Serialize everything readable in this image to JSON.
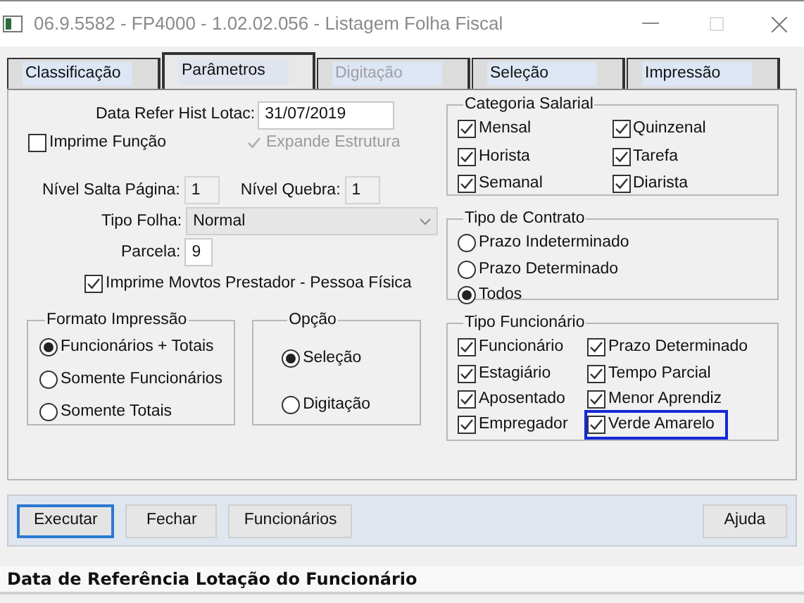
{
  "window": {
    "title": "06.9.5582 - FP4000 - 1.02.02.056 - Listagem Folha Fiscal"
  },
  "tabs": [
    {
      "label": "Classificação",
      "selected": false,
      "disabled": false
    },
    {
      "label": "Parâmetros",
      "selected": true,
      "disabled": false
    },
    {
      "label": "Digitação",
      "selected": false,
      "disabled": true
    },
    {
      "label": "Seleção",
      "selected": false,
      "disabled": false
    },
    {
      "label": "Impressão",
      "selected": false,
      "disabled": false
    }
  ],
  "date_field": {
    "label": "Data Refer Hist Lotac:",
    "value": "31/07/2019"
  },
  "imprime_funcao": {
    "label": "Imprime Função",
    "checked": false,
    "disabled": false
  },
  "expande_estrutura": {
    "label": "Expande Estrutura",
    "checked": true,
    "disabled": true
  },
  "nivel_salta_pagina": {
    "label": "Nível Salta Página:",
    "value": "1"
  },
  "nivel_quebra": {
    "label": "Nível Quebra:",
    "value": "1"
  },
  "tipo_folha": {
    "label": "Tipo Folha:",
    "value": "Normal"
  },
  "parcela": {
    "label": "Parcela:",
    "value": "9"
  },
  "imprime_movtos": {
    "label": "Imprime Movtos Prestador - Pessoa Física",
    "checked": true,
    "disabled": false
  },
  "formato_impressao": {
    "title": "Formato Impressão",
    "options": [
      {
        "label": "Funcionários + Totais",
        "selected": true
      },
      {
        "label": "Somente Funcionários",
        "selected": false
      },
      {
        "label": "Somente Totais",
        "selected": false
      }
    ]
  },
  "opcao": {
    "title": "Opção",
    "options": [
      {
        "label": "Seleção",
        "selected": true
      },
      {
        "label": "Digitação",
        "selected": false
      }
    ]
  },
  "categoria_salarial": {
    "title": "Categoria Salarial",
    "items": [
      {
        "label": "Mensal",
        "checked": true
      },
      {
        "label": "Quinzenal",
        "checked": true
      },
      {
        "label": "Horista",
        "checked": true
      },
      {
        "label": "Tarefa",
        "checked": true
      },
      {
        "label": "Semanal",
        "checked": true
      },
      {
        "label": "Diarista",
        "checked": true
      }
    ]
  },
  "tipo_contrato": {
    "title": "Tipo de Contrato",
    "options": [
      {
        "label": "Prazo Indeterminado",
        "selected": false
      },
      {
        "label": "Prazo Determinado",
        "selected": false
      },
      {
        "label": "Todos",
        "selected": true
      }
    ]
  },
  "tipo_funcionario": {
    "title": "Tipo Funcionário",
    "items": [
      {
        "label": "Funcionário",
        "checked": true,
        "focused": false
      },
      {
        "label": "Prazo Determinado",
        "checked": true,
        "focused": false
      },
      {
        "label": "Estagiário",
        "checked": true,
        "focused": false
      },
      {
        "label": "Tempo Parcial",
        "checked": true,
        "focused": false
      },
      {
        "label": "Aposentado",
        "checked": true,
        "focused": false
      },
      {
        "label": "Menor Aprendiz",
        "checked": true,
        "focused": false
      },
      {
        "label": "Empregador",
        "checked": true,
        "focused": false
      },
      {
        "label": "Verde Amarelo",
        "checked": true,
        "focused": true
      }
    ]
  },
  "buttons": [
    {
      "label": "Executar",
      "focused": true
    },
    {
      "label": "Fechar",
      "focused": false
    },
    {
      "label": "Funcionários",
      "focused": false
    }
  ],
  "help_button": {
    "label": "Ajuda"
  },
  "status_bar": {
    "text": "Data de Referência Lotação do Funcionário"
  }
}
